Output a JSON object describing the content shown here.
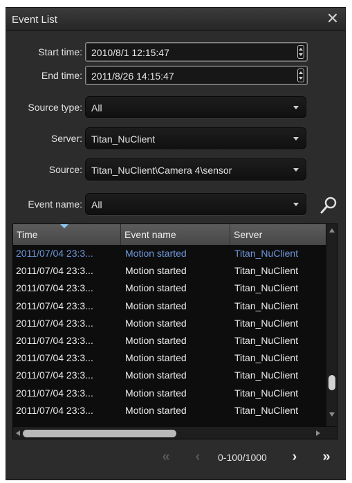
{
  "window": {
    "title": "Event List",
    "close_icon": "close-icon"
  },
  "filters": {
    "start_time": {
      "label": "Start time:",
      "value": "2010/8/1 12:15:47"
    },
    "end_time": {
      "label": "End time:",
      "value": "2011/8/26 14:15:47"
    },
    "source_type": {
      "label": "Source type:",
      "value": "All"
    },
    "server": {
      "label": "Server:",
      "value": "Titan_NuClient"
    },
    "source": {
      "label": "Source:",
      "value": "Titan_NuClient\\Camera 4\\sensor"
    },
    "event_name": {
      "label": "Event name:",
      "value": "All"
    },
    "search_icon": "search-icon"
  },
  "table": {
    "columns": [
      "Time",
      "Event name",
      "Server"
    ],
    "rows": [
      {
        "time": "2011/07/04  23:3...",
        "event": "Motion started",
        "server": "Titan_NuClient",
        "selected": true
      },
      {
        "time": "2011/07/04  23:3...",
        "event": "Motion started",
        "server": "Titan_NuClient"
      },
      {
        "time": "2011/07/04  23:3...",
        "event": "Motion started",
        "server": "Titan_NuClient"
      },
      {
        "time": "2011/07/04  23:3...",
        "event": "Motion started",
        "server": "Titan_NuClient"
      },
      {
        "time": "2011/07/04  23:3...",
        "event": "Motion started",
        "server": "Titan_NuClient"
      },
      {
        "time": "2011/07/04  23:3...",
        "event": "Motion started",
        "server": "Titan_NuClient"
      },
      {
        "time": "2011/07/04  23:3...",
        "event": "Motion started",
        "server": "Titan_NuClient"
      },
      {
        "time": "2011/07/04  23:3...",
        "event": "Motion started",
        "server": "Titan_NuClient"
      },
      {
        "time": "2011/07/04  23:3...",
        "event": "Motion started",
        "server": "Titan_NuClient"
      },
      {
        "time": "2011/07/04  23:3...",
        "event": "Motion started",
        "server": "Titan_NuClient"
      }
    ]
  },
  "pager": {
    "first": "«",
    "prev": "‹",
    "info": "0-100/1000",
    "next": "›",
    "last": "»"
  },
  "colors": {
    "selected_row_text": "#6f97db",
    "panel_bg": "#2c2c2c",
    "header_bg": "#545454"
  }
}
